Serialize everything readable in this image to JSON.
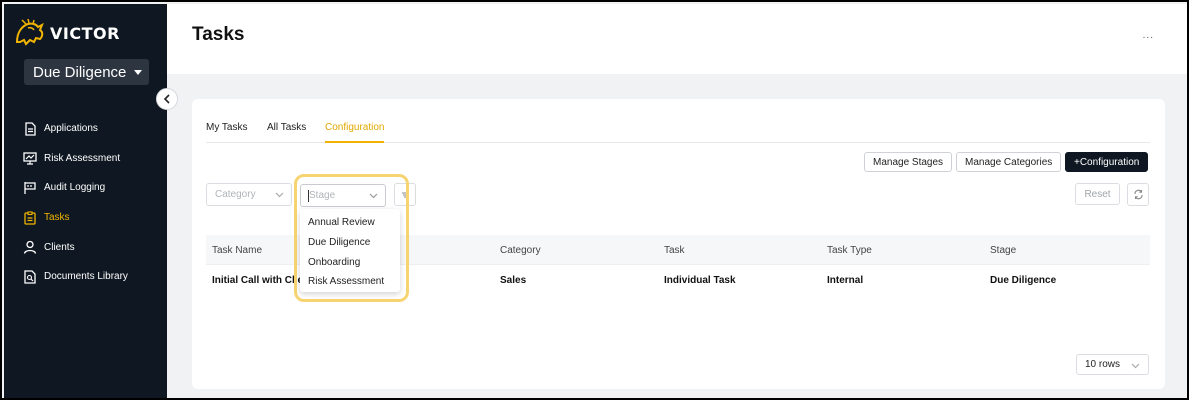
{
  "sidebar": {
    "brand": "VICTOR",
    "workspace": "Due Diligence",
    "items": [
      {
        "label": "Applications",
        "icon": "document-icon"
      },
      {
        "label": "Risk Assessment",
        "icon": "chart-presentation-icon"
      },
      {
        "label": "Audit Logging",
        "icon": "flag-icon"
      },
      {
        "label": "Tasks",
        "icon": "clipboard-icon",
        "active": true
      },
      {
        "label": "Clients",
        "icon": "user-icon"
      },
      {
        "label": "Documents Library",
        "icon": "document-search-icon"
      }
    ]
  },
  "header": {
    "title": "Tasks",
    "more": "..."
  },
  "tabs": [
    "My Tasks",
    "All Tasks",
    "Configuration"
  ],
  "active_tab": "Configuration",
  "actions": {
    "manage_stages": "Manage Stages",
    "manage_categories": "Manage Categories",
    "add_configuration": "+Configuration"
  },
  "filters": {
    "category_placeholder": "Category",
    "stage_placeholder": "Stage",
    "reset": "Reset",
    "stage_options": [
      "Annual Review",
      "Due Diligence",
      "Onboarding",
      "Risk Assessment"
    ]
  },
  "table": {
    "columns": [
      "Task Name",
      "Category",
      "Task",
      "Task Type",
      "Stage"
    ],
    "rows": [
      {
        "task_name": "Initial Call with Clie",
        "category": "Sales",
        "task": "Individual Task",
        "task_type": "Internal",
        "stage": "Due Diligence"
      }
    ]
  },
  "pagination": {
    "rows_per_page": "10 rows"
  },
  "colors": {
    "accent": "#f0b400",
    "sidebar_bg": "#0f1822",
    "highlight": "#f6d472"
  }
}
